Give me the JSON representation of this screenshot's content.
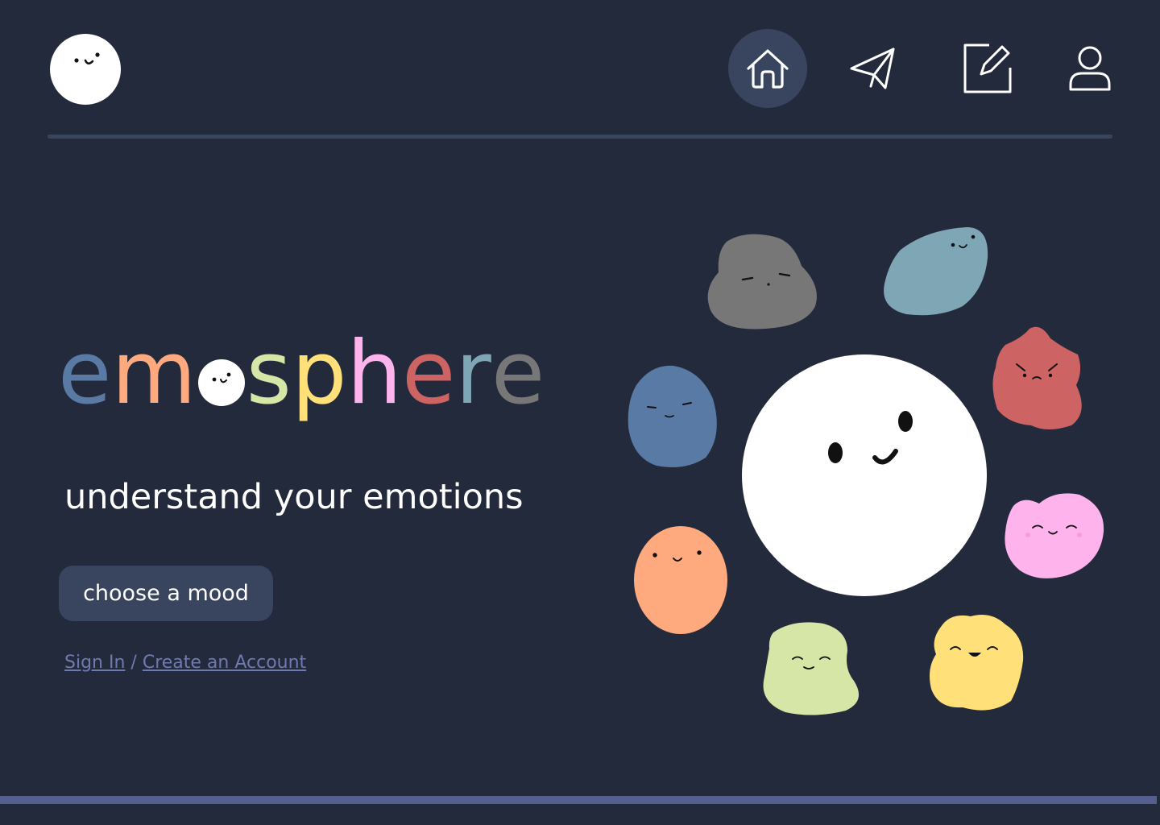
{
  "colors": {
    "background": "#232a3b",
    "nav_active": "#39445e",
    "divider": "#39445e",
    "footer_bar": "#545f8e",
    "link": "#6f7ab0",
    "letters": [
      "#5a7aa6",
      "#ffa97f",
      "#ffffff",
      "#d6e6a6",
      "#ffe079",
      "#ffb3ed",
      "#cd6363",
      "#7fa6b5",
      "#777777"
    ]
  },
  "nav": {
    "items": [
      {
        "name": "home",
        "icon": "home-icon",
        "active": true
      },
      {
        "name": "send",
        "icon": "paper-plane-icon",
        "active": false
      },
      {
        "name": "write",
        "icon": "edit-icon",
        "active": false
      },
      {
        "name": "profile",
        "icon": "user-icon",
        "active": false
      }
    ]
  },
  "hero": {
    "brand_letters": [
      "e",
      "m",
      "o",
      "s",
      "p",
      "h",
      "e",
      "r",
      "e"
    ],
    "tagline": "understand your emotions",
    "cta_label": "choose a mood",
    "sign_in": "Sign In",
    "separator": " / ",
    "create_account": "Create an Account"
  },
  "moods": [
    {
      "name": "neutral",
      "color": "#777777",
      "icon": "neutral-face-icon"
    },
    {
      "name": "calm",
      "color": "#7fa6b5",
      "icon": "calm-face-icon"
    },
    {
      "name": "angry",
      "color": "#cd6363",
      "icon": "angry-face-icon"
    },
    {
      "name": "loved",
      "color": "#ffb3ed",
      "icon": "blushing-face-icon"
    },
    {
      "name": "joyful",
      "color": "#ffe079",
      "icon": "laughing-face-icon"
    },
    {
      "name": "content",
      "color": "#d6e6a6",
      "icon": "content-face-icon"
    },
    {
      "name": "curious",
      "color": "#ffa97f",
      "icon": "smiling-face-icon"
    },
    {
      "name": "sad",
      "color": "#5a7aa6",
      "icon": "sleepy-face-icon"
    },
    {
      "name": "center",
      "color": "#ffffff",
      "icon": "happy-face-icon"
    }
  ]
}
